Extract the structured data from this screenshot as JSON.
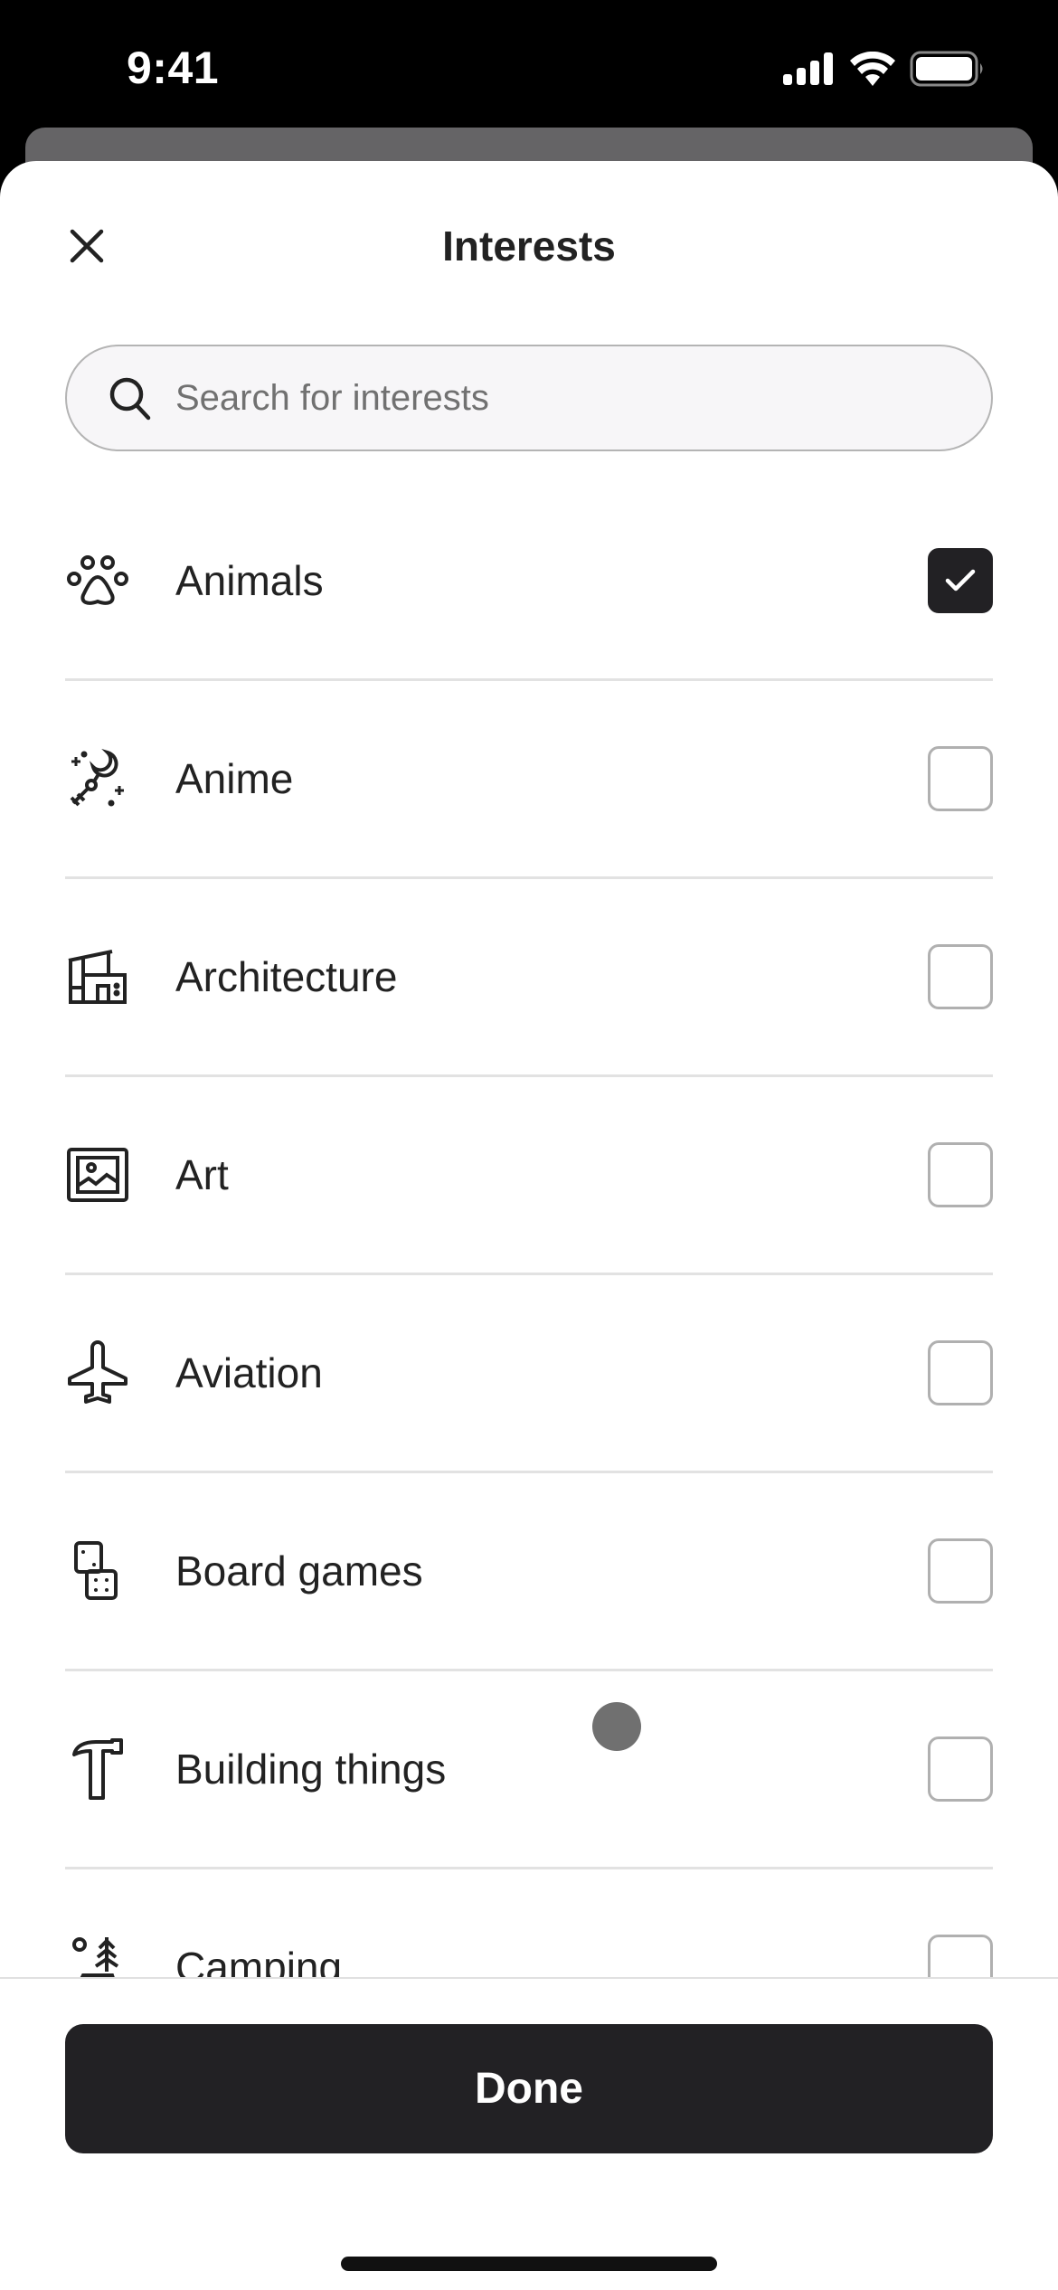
{
  "status_bar": {
    "time": "9:41",
    "icons": [
      "cellular-signal-icon",
      "wifi-icon",
      "battery-icon"
    ]
  },
  "sheet": {
    "title": "Interests",
    "close_icon": "close-icon",
    "search": {
      "placeholder": "Search for interests",
      "value": "",
      "icon": "search-icon"
    },
    "items": [
      {
        "label": "Animals",
        "icon": "paw-icon",
        "checked": true
      },
      {
        "label": "Anime",
        "icon": "magic-wand-moon-icon",
        "checked": false
      },
      {
        "label": "Architecture",
        "icon": "building-icon",
        "checked": false
      },
      {
        "label": "Art",
        "icon": "framed-picture-icon",
        "checked": false
      },
      {
        "label": "Aviation",
        "icon": "airplane-icon",
        "checked": false
      },
      {
        "label": "Board games",
        "icon": "dice-icon",
        "checked": false
      },
      {
        "label": "Building things",
        "icon": "hammer-icon",
        "checked": false
      },
      {
        "label": "Camping",
        "icon": "camping-tent-tree-icon",
        "checked": false
      }
    ],
    "done_button": "Done"
  },
  "colors": {
    "primary_dark": "#222124",
    "checkbox_border": "#b0b0b0",
    "divider": "#e2e2e2",
    "search_bg": "#f7f6f8"
  }
}
